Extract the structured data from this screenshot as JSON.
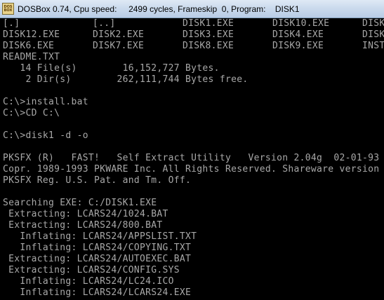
{
  "window": {
    "title": "DOSBox 0.74, Cpu speed:     2499 cycles, Frameskip  0, Program:    DISK1",
    "icon": "dosbox-icon",
    "icon_label": "DOS BOX"
  },
  "console": {
    "dir_listing": {
      "rows": [
        [
          "[.]",
          "[..]",
          "DISK1.EXE",
          "DISK10.EXE",
          "DISK"
        ],
        [
          "DISK12.EXE",
          "DISK2.EXE",
          "DISK3.EXE",
          "DISK4.EXE",
          "DISK"
        ],
        [
          "DISK6.EXE",
          "DISK7.EXE",
          "DISK8.EXE",
          "DISK9.EXE",
          "INST"
        ],
        [
          "README.TXT",
          "",
          "",
          "",
          ""
        ]
      ],
      "files_summary": "   14 File(s)        16,152,727 Bytes.",
      "dirs_summary": "    2 Dir(s)        262,111,744 Bytes free."
    },
    "lines": [
      "",
      "C:\\>install.bat",
      "C:\\>CD C:\\",
      "",
      "C:\\>disk1 -d -o",
      "",
      "PKSFX (R)   FAST!   Self Extract Utility   Version 2.04g  02-01-93",
      "Copr. 1989-1993 PKWARE Inc. All Rights Reserved. Shareware version",
      "PKSFX Reg. U.S. Pat. and Tm. Off.",
      "",
      "Searching EXE: C:/DISK1.EXE",
      " Extracting: LCARS24/1024.BAT",
      " Extracting: LCARS24/800.BAT",
      "   Inflating: LCARS24/APPSLIST.TXT",
      "   Inflating: LCARS24/COPYING.TXT",
      " Extracting: LCARS24/AUTOEXEC.BAT",
      " Extracting: LCARS24/CONFIG.SYS",
      "   Inflating: LCARS24/LC24.ICO",
      "   Inflating: LCARS24/LCARS24.EXE"
    ]
  },
  "colors": {
    "console_bg": "#000000",
    "console_fg": "#a8a8a8"
  }
}
